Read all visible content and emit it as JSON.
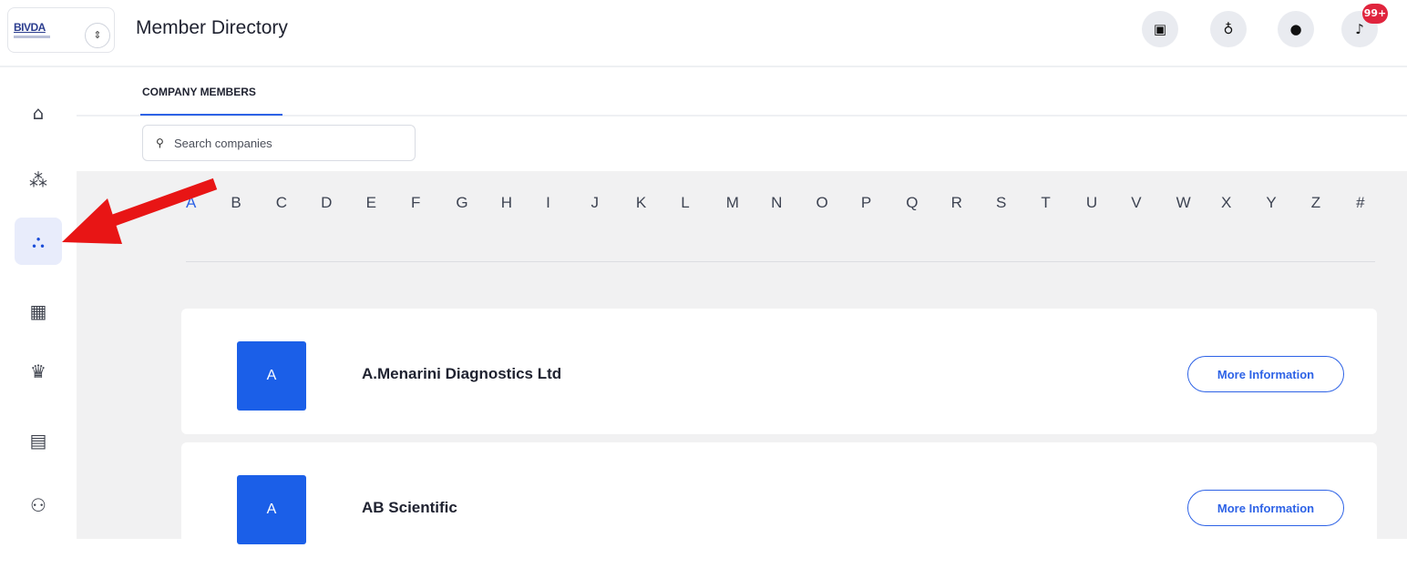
{
  "header": {
    "logo_text": "BIVDA",
    "switcher_icon": "chevron-updown-icon",
    "title": "Member Directory",
    "icons": [
      "ticket-icon",
      "award-icon",
      "chat-icon",
      "bell-icon"
    ],
    "notification_badge": "99+"
  },
  "sidebar": {
    "items": [
      {
        "icon": "home-icon",
        "glyph": "⌂"
      },
      {
        "icon": "community-icon",
        "glyph": "⁂"
      },
      {
        "icon": "network-icon",
        "glyph": "⛬",
        "active": true
      },
      {
        "icon": "calendar-icon",
        "glyph": "▦"
      },
      {
        "icon": "crown-icon",
        "glyph": "♛"
      },
      {
        "icon": "inbox-icon",
        "glyph": "▤"
      },
      {
        "icon": "users-icon",
        "glyph": "⚇"
      }
    ]
  },
  "tabs": {
    "active_label": "COMPANY MEMBERS"
  },
  "search": {
    "placeholder": "Search companies",
    "icon": "search-icon"
  },
  "alphabet": [
    "A",
    "B",
    "C",
    "D",
    "E",
    "F",
    "G",
    "H",
    "I",
    "J",
    "K",
    "L",
    "M",
    "N",
    "O",
    "P",
    "Q",
    "R",
    "S",
    "T",
    "U",
    "V",
    "W",
    "X",
    "Y",
    "Z",
    "#"
  ],
  "active_letter": "A",
  "companies": [
    {
      "initial": "A",
      "name": "A.Menarini Diagnostics Ltd",
      "button": "More Information"
    },
    {
      "initial": "A",
      "name": "AB Scientific",
      "button": "More Information"
    }
  ],
  "colors": {
    "accent": "#2d62e6",
    "avatar": "#1b5fe8",
    "badge": "#e0243d",
    "annotation_arrow": "#e81515"
  }
}
